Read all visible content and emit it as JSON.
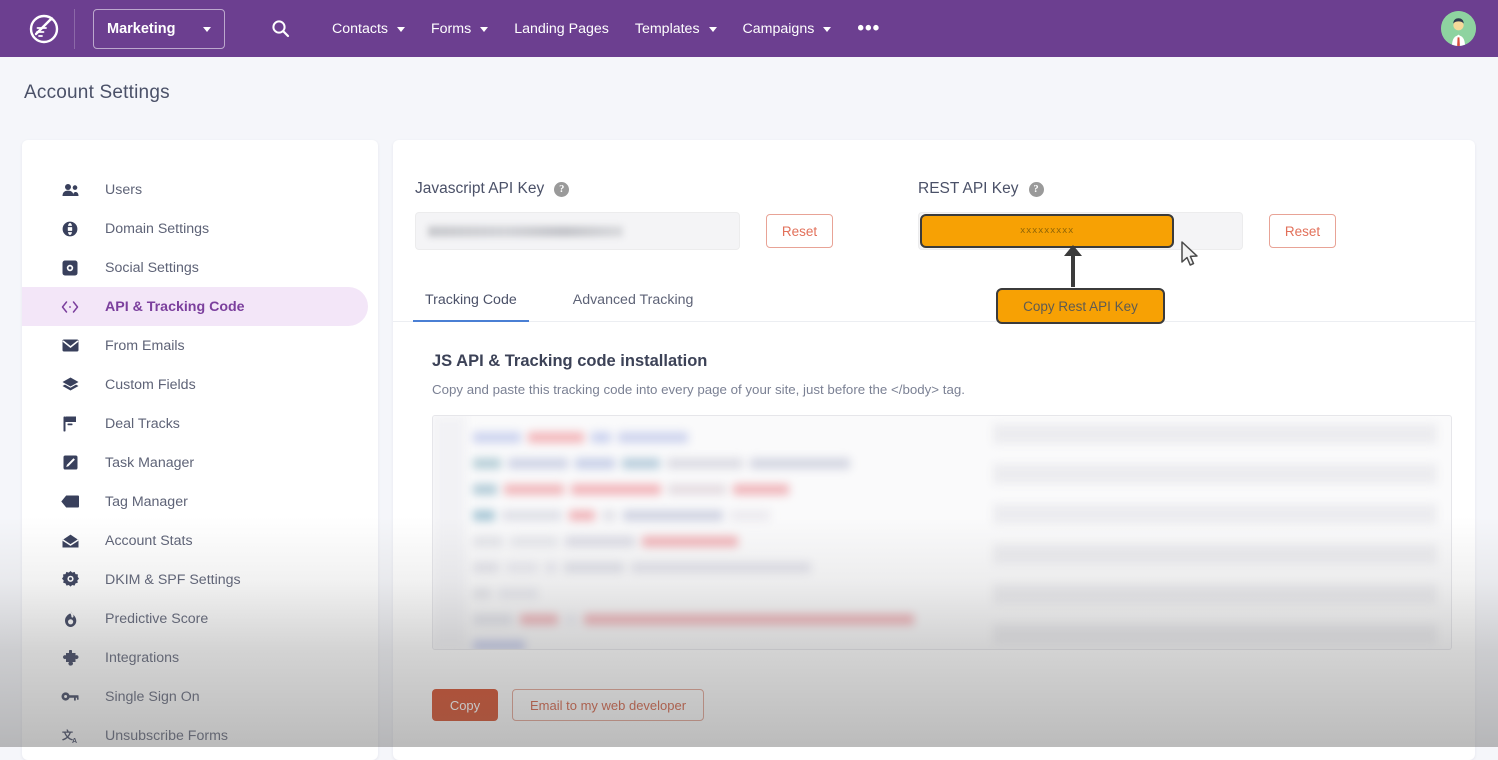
{
  "topnav": {
    "logo_icon": "pipeline-logo-icon",
    "app_switcher": {
      "label": "Marketing",
      "icon": "chevron-down-icon"
    },
    "search_icon": "search-icon",
    "items": [
      {
        "label": "Contacts",
        "has_caret": true
      },
      {
        "label": "Forms",
        "has_caret": true
      },
      {
        "label": "Landing Pages",
        "has_caret": false
      },
      {
        "label": "Templates",
        "has_caret": true
      },
      {
        "label": "Campaigns",
        "has_caret": true
      }
    ],
    "more_label": "•••",
    "avatar_name": "user-avatar",
    "bg_color": "#6c3f90"
  },
  "page": {
    "title": "Account Settings"
  },
  "sidebar": {
    "items": [
      {
        "label": "Users",
        "icon": "users-icon",
        "active": false
      },
      {
        "label": "Domain Settings",
        "icon": "globe-icon",
        "active": false
      },
      {
        "label": "Social Settings",
        "icon": "social-share-icon",
        "active": false
      },
      {
        "label": "API & Tracking Code",
        "icon": "code-brackets-icon",
        "active": true
      },
      {
        "label": "From Emails",
        "icon": "envelope-icon",
        "active": false
      },
      {
        "label": "Custom Fields",
        "icon": "layers-icon",
        "active": false
      },
      {
        "label": "Deal Tracks",
        "icon": "flag-icon",
        "active": false
      },
      {
        "label": "Task Manager",
        "icon": "task-edit-icon",
        "active": false
      },
      {
        "label": "Tag Manager",
        "icon": "tag-icon",
        "active": false
      },
      {
        "label": "Account Stats",
        "icon": "open-envelope-icon",
        "active": false
      },
      {
        "label": "DKIM & SPF Settings",
        "icon": "gear-icon",
        "active": false
      },
      {
        "label": "Predictive Score",
        "icon": "flame-icon",
        "active": false
      },
      {
        "label": "Integrations",
        "icon": "puzzle-icon",
        "active": false
      },
      {
        "label": "Single Sign On",
        "icon": "key-icon",
        "active": false
      },
      {
        "label": "Unsubscribe Forms",
        "icon": "translate-icon",
        "active": false
      }
    ],
    "active_bg": "#f3e6f8",
    "active_color": "#7b3f9d"
  },
  "main": {
    "js_key": {
      "label": "Javascript API Key",
      "help_icon": "help-circle-icon",
      "value": "",
      "reset_label": "Reset"
    },
    "rest_key": {
      "label": "REST API Key",
      "help_icon": "help-circle-icon",
      "masked_value": "xxxxxxxxx",
      "reset_label": "Reset",
      "highlight_color": "#f7a104"
    },
    "tooltip": {
      "text": "Copy Rest API Key",
      "bg_color": "#f7a104",
      "border_color": "#3b3b3b"
    },
    "tabs": [
      {
        "label": "Tracking Code",
        "active": true
      },
      {
        "label": "Advanced Tracking",
        "active": false
      }
    ],
    "tab_underline_color": "#4a7fd4",
    "section": {
      "title": "JS API & Tracking code installation",
      "subtitle": "Copy and paste this tracking code into every page of your site, just before the </body> tag."
    },
    "buttons": {
      "copy_label": "Copy",
      "copy_color": "#d2441f",
      "email_label": "Email to my web developer",
      "email_color": "#d35b3e"
    }
  }
}
